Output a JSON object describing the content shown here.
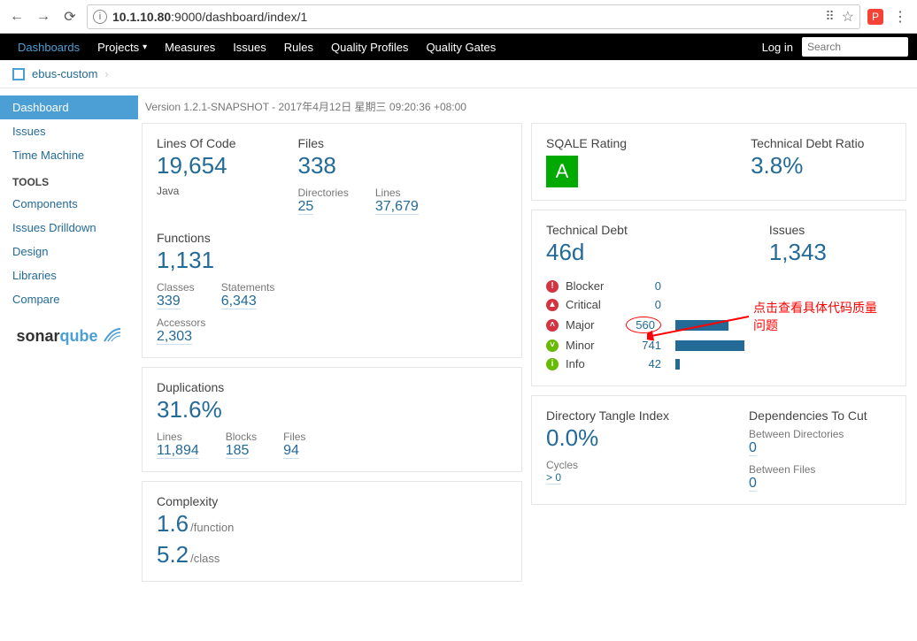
{
  "browser": {
    "url_host": "10.1.10.80",
    "url_rest": ":9000/dashboard/index/1"
  },
  "nav": {
    "dashboards": "Dashboards",
    "projects": "Projects",
    "measures": "Measures",
    "issues": "Issues",
    "rules": "Rules",
    "quality_profiles": "Quality Profiles",
    "quality_gates": "Quality Gates",
    "login": "Log in",
    "search_placeholder": "Search"
  },
  "breadcrumb": {
    "project": "ebus-custom"
  },
  "sidebar": {
    "items": [
      "Dashboard",
      "Issues",
      "Time Machine"
    ],
    "tools_heading": "TOOLS",
    "tools": [
      "Components",
      "Issues Drilldown",
      "Design",
      "Libraries",
      "Compare"
    ],
    "logo_a": "sonar",
    "logo_b": "qube"
  },
  "version_line": "Version 1.2.1-SNAPSHOT - 2017年4月12日 星期三 09:20:36 +08:00",
  "left": {
    "size": {
      "loc_label": "Lines Of Code",
      "loc": "19,654",
      "lang": "Java",
      "files_label": "Files",
      "files": "338",
      "dirs_label": "Directories",
      "dirs": "25",
      "lines_label": "Lines",
      "lines": "37,679",
      "funcs_label": "Functions",
      "funcs": "1,131",
      "classes_label": "Classes",
      "classes": "339",
      "stmts_label": "Statements",
      "stmts": "6,343",
      "accessors_label": "Accessors",
      "accessors": "2,303"
    },
    "dup": {
      "title": "Duplications",
      "pct": "31.6%",
      "lines_label": "Lines",
      "lines": "11,894",
      "blocks_label": "Blocks",
      "blocks": "185",
      "files_label": "Files",
      "files": "94"
    },
    "cx": {
      "title": "Complexity",
      "per_func": "1.6",
      "per_func_unit": "/function",
      "per_class": "5.2",
      "per_class_unit": "/class"
    }
  },
  "right": {
    "sqale_label": "SQALE Rating",
    "sqale_grade": "A",
    "tdr_label": "Technical Debt Ratio",
    "tdr": "3.8%",
    "debt_label": "Technical Debt",
    "debt": "46d",
    "issues_label": "Issues",
    "issues": "1,343",
    "sev": {
      "blocker": {
        "label": "Blocker",
        "count": "0",
        "bar": 0
      },
      "critical": {
        "label": "Critical",
        "count": "0",
        "bar": 0
      },
      "major": {
        "label": "Major",
        "count": "560",
        "bar": 60
      },
      "minor": {
        "label": "Minor",
        "count": "741",
        "bar": 78
      },
      "info": {
        "label": "Info",
        "count": "42",
        "bar": 5
      }
    },
    "tangle": {
      "title": "Directory Tangle Index",
      "pct": "0.0%",
      "cycles_label": "Cycles",
      "cycles": "> 0"
    },
    "deps": {
      "title": "Dependencies To Cut",
      "bd_label": "Between Directories",
      "bd": "0",
      "bf_label": "Between Files",
      "bf": "0"
    }
  },
  "annotation": "点击查看具体代码质量问题"
}
